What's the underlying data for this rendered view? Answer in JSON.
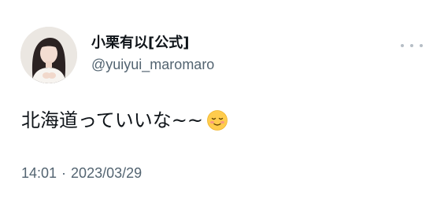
{
  "tweet": {
    "author": {
      "display_name": "小栗有以[公式]",
      "handle": "@yuiyui_maromaro",
      "avatar_icon": "profile-photo"
    },
    "more_icon": "more-horizontal-icon",
    "text": "北海道っていいな~~",
    "emoji": "smiling-face-icon",
    "time": "14:01",
    "separator": "·",
    "date": "2023/03/29"
  },
  "colors": {
    "text_primary": "#0f1419",
    "text_secondary": "#536471",
    "background": "#ffffff"
  }
}
